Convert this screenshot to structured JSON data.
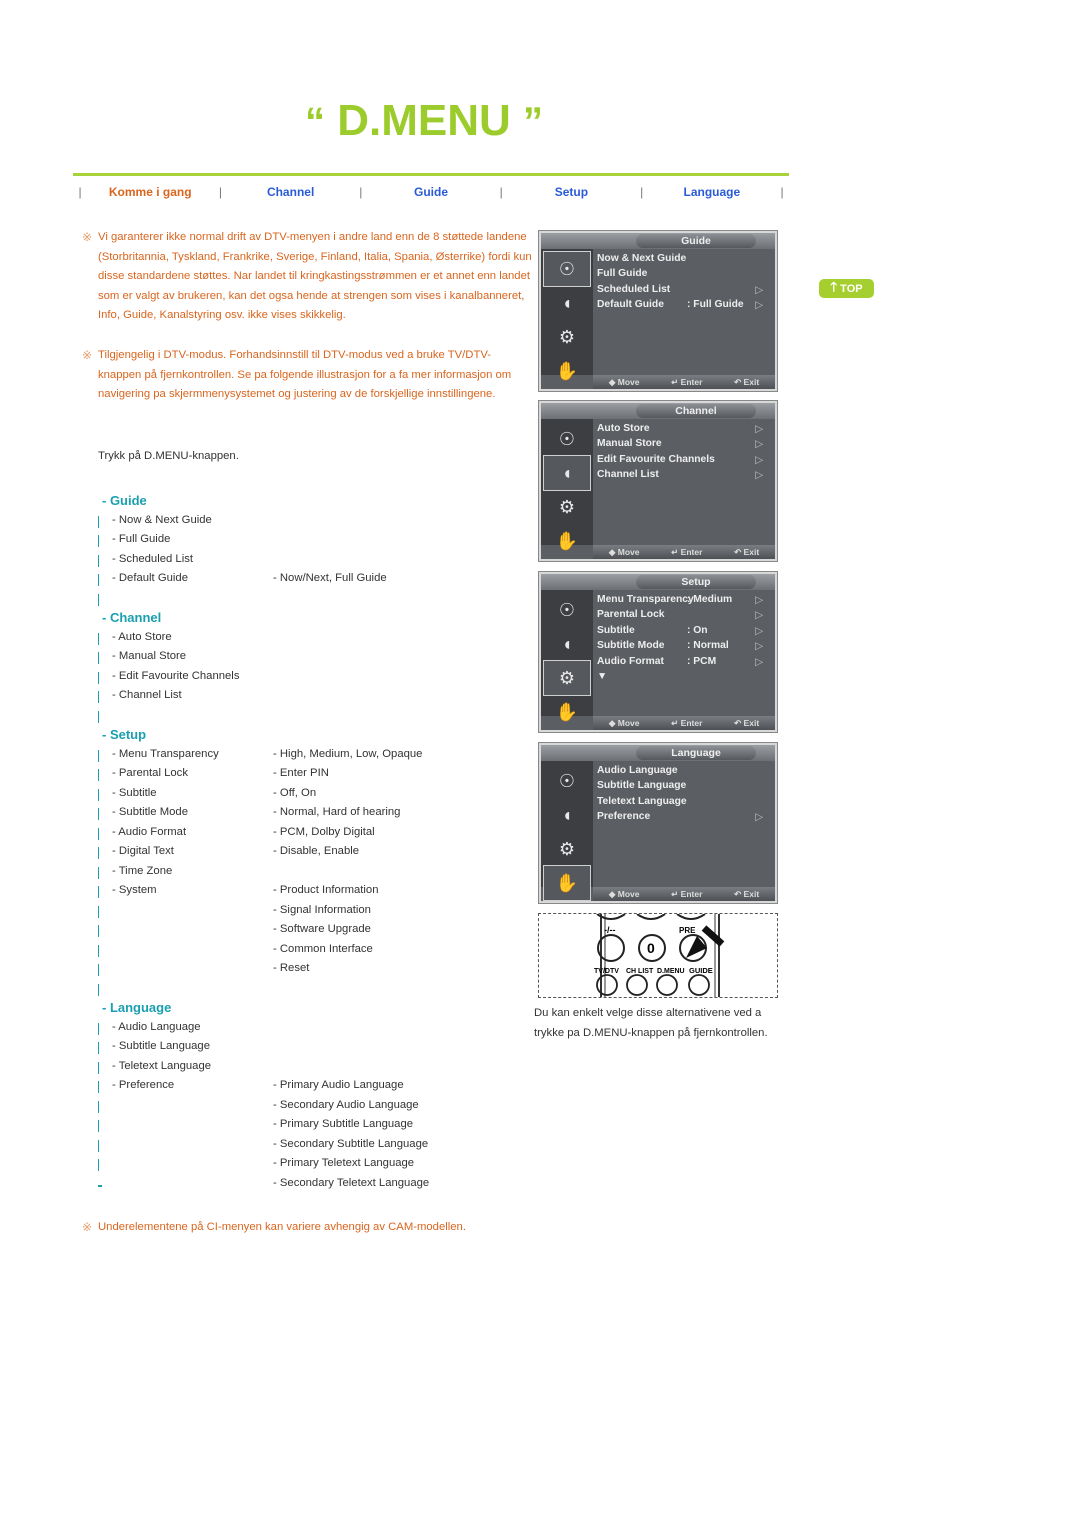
{
  "page": {
    "title_open_quote": "“",
    "title": "D.MENU",
    "title_close_quote": "”",
    "top_button": "TOP"
  },
  "nav": {
    "tabs": [
      {
        "label": "Komme i gang",
        "active": true
      },
      {
        "label": "Channel",
        "active": false
      },
      {
        "label": "Guide",
        "active": false
      },
      {
        "label": "Setup",
        "active": false
      },
      {
        "label": "Language",
        "active": false
      }
    ]
  },
  "notes": {
    "mark": "※",
    "note1": "Vi garanterer ikke normal drift av DTV-menyen i andre land enn de 8 støttede landene (Storbritannia, Tyskland, Frankrike, Sverige, Finland, Italia, Spania, Østerrike) fordi kun disse standardene støttes. Nar landet til kringkastingsstrømmen er et annet enn landet som er valgt av brukeren, kan det ogsa hende at strengen som vises i kanalbanneret, Info, Guide, Kanalstyring osv. ikke vises skikkelig.",
    "note2": "Tilgjengelig i DTV-modus. Forhandsinnstill til DTV-modus ved a bruke TV/DTV-knappen på fjernkontrollen. Se pa folgende illustrasjon for a fa mer informasjon om navigering pa skjermmenysystemet og justering av de forskjellige innstillingene.",
    "instruction": "Trykk på D.MENU-knappen.",
    "footer_note": "Underelementene på CI-menyen kan variere avhengig av CAM-modellen."
  },
  "sections": {
    "guide": {
      "heading": "- Guide",
      "rows": [
        {
          "item": "- Now & Next Guide",
          "value": ""
        },
        {
          "item": "- Full Guide",
          "value": ""
        },
        {
          "item": "- Scheduled List",
          "value": ""
        },
        {
          "item": "- Default Guide",
          "value": "- Now/Next, Full Guide"
        },
        {
          "item": "",
          "value": ""
        }
      ]
    },
    "channel": {
      "heading": "- Channel",
      "rows": [
        {
          "item": "- Auto Store",
          "value": ""
        },
        {
          "item": "- Manual Store",
          "value": ""
        },
        {
          "item": "- Edit Favourite Channels",
          "value": ""
        },
        {
          "item": "- Channel List",
          "value": ""
        },
        {
          "item": "",
          "value": ""
        }
      ]
    },
    "setup": {
      "heading": "- Setup",
      "rows": [
        {
          "item": "- Menu Transparency",
          "value": "- High, Medium, Low, Opaque"
        },
        {
          "item": "- Parental Lock",
          "value": "- Enter PIN"
        },
        {
          "item": "- Subtitle",
          "value": "- Off, On"
        },
        {
          "item": "- Subtitle Mode",
          "value": "- Normal, Hard of hearing"
        },
        {
          "item": "- Audio Format",
          "value": "- PCM, Dolby Digital"
        },
        {
          "item": "- Digital Text",
          "value": "- Disable, Enable"
        },
        {
          "item": "- Time Zone",
          "value": ""
        },
        {
          "item": "- System",
          "value": "- Product Information"
        },
        {
          "item": "",
          "value": "- Signal Information"
        },
        {
          "item": "",
          "value": "- Software Upgrade"
        },
        {
          "item": "",
          "value": "- Common Interface"
        },
        {
          "item": "",
          "value": "- Reset"
        },
        {
          "item": "",
          "value": ""
        }
      ]
    },
    "language": {
      "heading": "- Language",
      "rows": [
        {
          "item": "- Audio Language",
          "value": ""
        },
        {
          "item": "- Subtitle Language",
          "value": ""
        },
        {
          "item": "- Teletext Language",
          "value": ""
        },
        {
          "item": "- Preference",
          "value": "- Primary Audio Language"
        },
        {
          "item": "",
          "value": "- Secondary Audio Language"
        },
        {
          "item": "",
          "value": "- Primary Subtitle Language"
        },
        {
          "item": "",
          "value": "- Secondary Subtitle Language"
        },
        {
          "item": "",
          "value": "- Primary Teletext Language"
        },
        {
          "item": "",
          "value": "- Secondary Teletext Language"
        }
      ]
    }
  },
  "tv_menus": [
    {
      "title": "Guide",
      "selected_icon": 0,
      "items": [
        {
          "label": "Now & Next Guide",
          "value": "",
          "arrow": false
        },
        {
          "label": "Full Guide",
          "value": "",
          "arrow": false
        },
        {
          "label": "Scheduled List",
          "value": "",
          "arrow": true
        },
        {
          "label": "Default Guide",
          "value": ": Full Guide",
          "arrow": true
        }
      ]
    },
    {
      "title": "Channel",
      "selected_icon": 1,
      "items": [
        {
          "label": "Auto Store",
          "value": "",
          "arrow": true
        },
        {
          "label": "Manual Store",
          "value": "",
          "arrow": true
        },
        {
          "label": "Edit Favourite Channels",
          "value": "",
          "arrow": true
        },
        {
          "label": "Channel List",
          "value": "",
          "arrow": true
        }
      ]
    },
    {
      "title": "Setup",
      "selected_icon": 2,
      "items": [
        {
          "label": "Menu Transparency",
          "value": ": Medium",
          "arrow": true
        },
        {
          "label": "Parental Lock",
          "value": "",
          "arrow": true
        },
        {
          "label": "Subtitle",
          "value": ": On",
          "arrow": true
        },
        {
          "label": "Subtitle  Mode",
          "value": ": Normal",
          "arrow": true
        },
        {
          "label": "Audio Format",
          "value": ": PCM",
          "arrow": true
        },
        {
          "label": "▼",
          "value": "",
          "arrow": false
        }
      ]
    },
    {
      "title": "Language",
      "selected_icon": 3,
      "items": [
        {
          "label": "Audio Language",
          "value": "",
          "arrow": false
        },
        {
          "label": "Subtitle Language",
          "value": "",
          "arrow": false
        },
        {
          "label": "Teletext Language",
          "value": "",
          "arrow": false
        },
        {
          "label": "Preference",
          "value": "",
          "arrow": true
        }
      ]
    }
  ],
  "tv_footer": {
    "move": "◆ Move",
    "enter": "↵ Enter",
    "exit": "↶ Exit"
  },
  "remote": {
    "top_labels": [
      "-/--",
      "0",
      "PRE-CH"
    ],
    "top_keys": [
      "",
      "0",
      ""
    ],
    "bottom_labels": [
      "TV/DTV",
      "CH LIST",
      "D.MENU",
      "GUIDE"
    ]
  },
  "caption": "Du kan enkelt velge disse alternativene ved a trykke pa D.MENU-knappen på fjernkontrollen."
}
